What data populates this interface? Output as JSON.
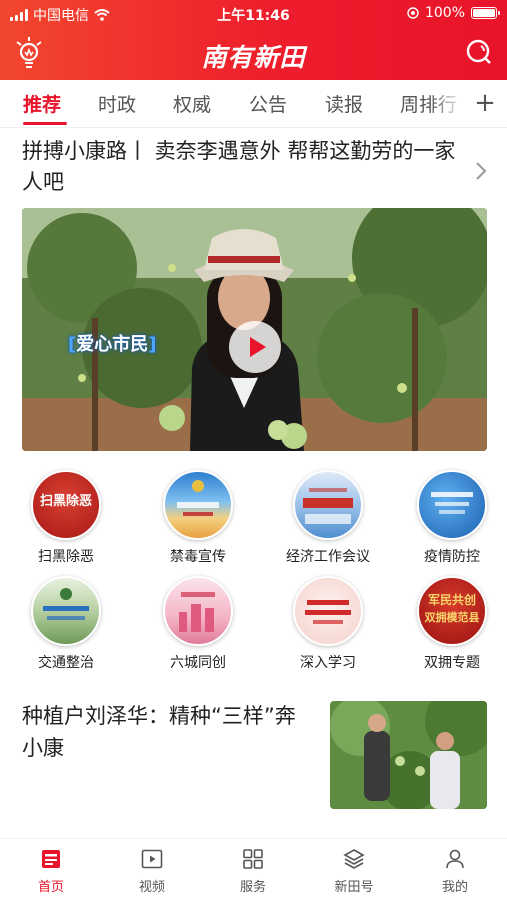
{
  "status_bar": {
    "carrier": "中国电信",
    "time": "上午11:46",
    "battery": "100%"
  },
  "header": {
    "app_title": "南有新田"
  },
  "tabs": [
    {
      "label": "推荐",
      "active": true
    },
    {
      "label": "时政"
    },
    {
      "label": "权威"
    },
    {
      "label": "公告"
    },
    {
      "label": "读报"
    },
    {
      "label": "周排行"
    }
  ],
  "headline": {
    "text": "拼搏小康路丨 卖奈李遇意外 帮帮这勤劳的一家人吧"
  },
  "hero": {
    "badge": "爱心市民"
  },
  "grid": [
    {
      "label": "扫黑除恶",
      "icon_text": "扫黑除恶"
    },
    {
      "label": "禁毒宣传"
    },
    {
      "label": "经济工作会议"
    },
    {
      "label": "疫情防控"
    },
    {
      "label": "交通整治"
    },
    {
      "label": "六城同创"
    },
    {
      "label": "深入学习"
    },
    {
      "label": "双拥专题",
      "icon_text_1": "军民共创",
      "icon_text_2": "双拥模范县"
    }
  ],
  "article": {
    "title": "种植户刘泽华：精种“三样”奔小康"
  },
  "bottom_nav": [
    {
      "label": "首页",
      "icon": "home-icon",
      "active": true
    },
    {
      "label": "视频",
      "icon": "video-icon"
    },
    {
      "label": "服务",
      "icon": "grid-icon"
    },
    {
      "label": "新田号",
      "icon": "layers-icon"
    },
    {
      "label": "我的",
      "icon": "user-icon"
    }
  ],
  "colors": {
    "brand_red": "#e8142a",
    "header_gradient_start": "#f2472f"
  }
}
